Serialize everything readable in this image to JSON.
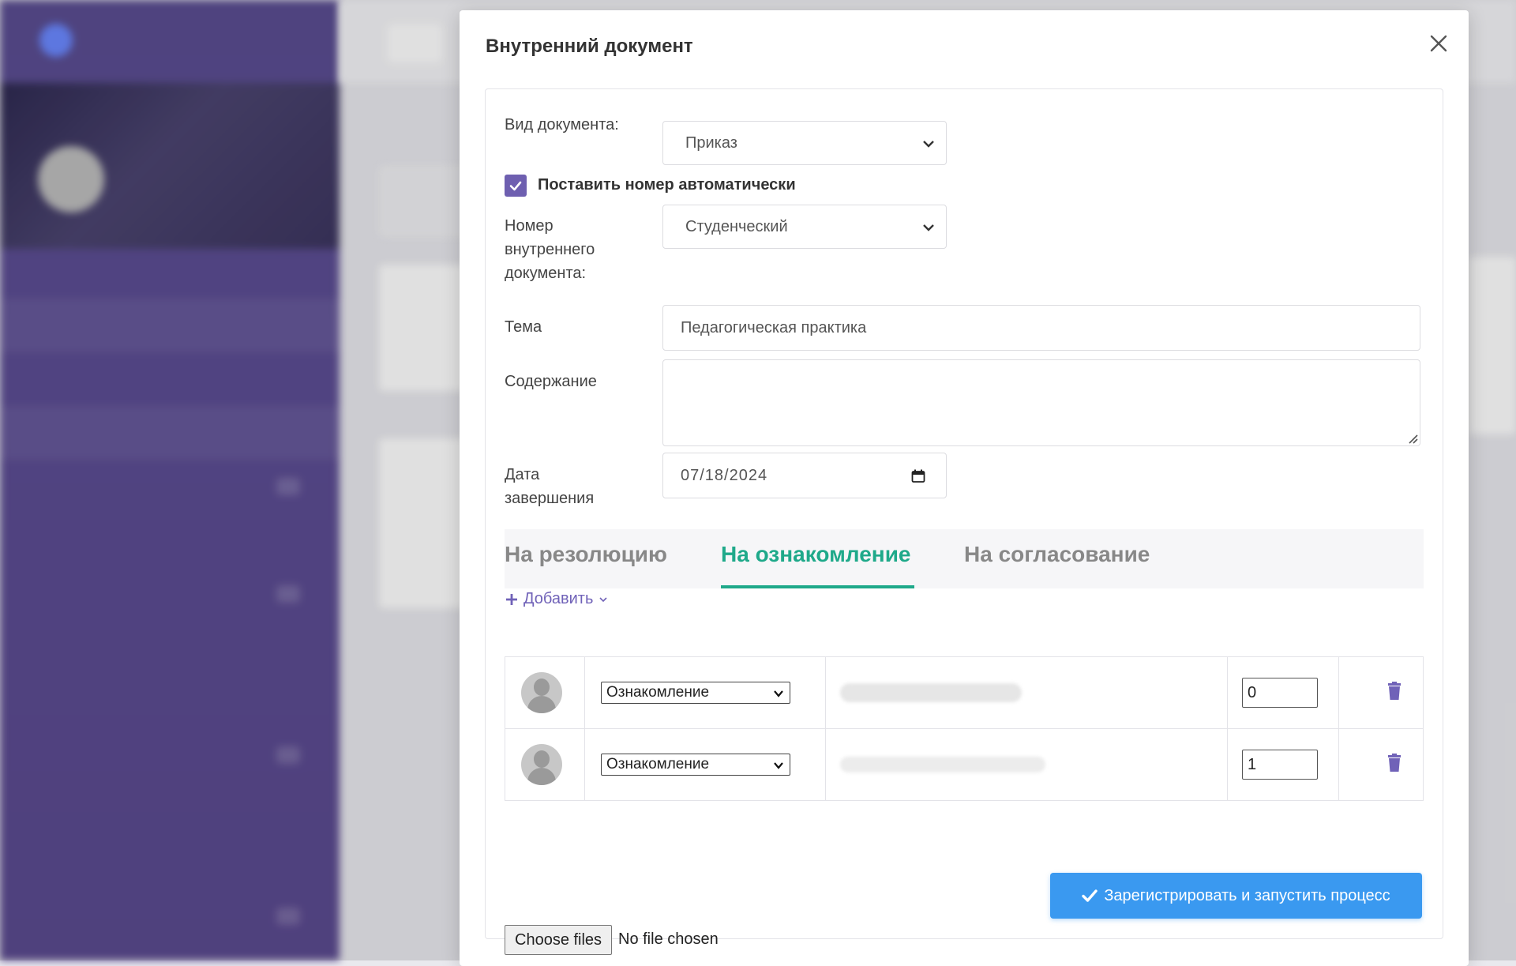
{
  "modal": {
    "title": "Внутренний документ",
    "fields": {
      "doc_type_label": "Вид документа:",
      "doc_type_value": "Приказ",
      "auto_number_label": "Поставить номер автоматически",
      "auto_number_checked": true,
      "internal_number_label_1": "Номер",
      "internal_number_label_2": "внутреннего",
      "internal_number_label_3": "документа:",
      "internal_number_value": "Студенческий",
      "subject_label": "Тема",
      "subject_value": "Педагогическая практика",
      "content_label": "Содержание",
      "content_value": "",
      "due_date_label_1": "Дата",
      "due_date_label_2": "завершения",
      "due_date_value": "07/18/2024"
    },
    "tabs": [
      {
        "label": "На резолюцию",
        "active": false
      },
      {
        "label": "На ознакомление",
        "active": true
      },
      {
        "label": "На согласование",
        "active": false
      }
    ],
    "add_label": "Добавить",
    "rows": [
      {
        "action": "Ознакомление",
        "order": "0"
      },
      {
        "action": "Ознакомление",
        "order": "1"
      }
    ],
    "file": {
      "button_label": "Choose files",
      "status": "No file chosen"
    },
    "submit_label": "Зарегистрировать и запустить процесс"
  },
  "colors": {
    "accent_purple": "#6e5fb0",
    "tab_active": "#1fa98a",
    "primary_button": "#3a99f0"
  }
}
